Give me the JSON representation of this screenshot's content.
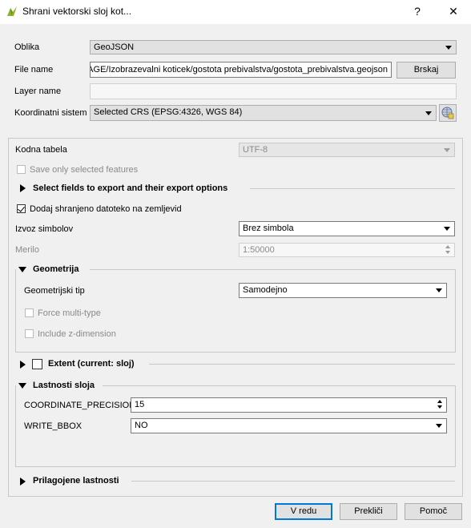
{
  "window": {
    "title": "Shrani vektorski sloj kot...",
    "help_label": "?",
    "close_label": "✕"
  },
  "form": {
    "format_label": "Oblika",
    "format_value": "GeoJSON",
    "filename_label": "File name",
    "filename_value": "AGE/Izobrazevalni koticek/gostota prebivalstva/gostota_prebivalstva.geojson",
    "browse_label": "Brskaj",
    "layername_label": "Layer name",
    "layername_value": "",
    "crs_label": "Koordinatni sistem",
    "crs_value": "Selected CRS (EPSG:4326, WGS 84)"
  },
  "options": {
    "encoding_label": "Kodna tabela",
    "encoding_value": "UTF-8",
    "save_selected_label": "Save only selected features",
    "select_fields_label": "Select fields to export and their export options",
    "add_to_map_label": "Dodaj shranjeno datoteko na zemljevid",
    "add_to_map_checked": true,
    "symbology_label": "Izvoz simbolov",
    "symbology_value": "Brez simbola",
    "scale_label": "Merilo",
    "scale_value": "1:50000"
  },
  "geometry": {
    "group_label": "Geometrija",
    "type_label": "Geometrijski tip",
    "type_value": "Samodejno",
    "force_multi_label": "Force multi-type",
    "include_z_label": "Include z-dimension"
  },
  "extent": {
    "group_label": "Extent (current: sloj)"
  },
  "layer_options": {
    "group_label": "Lastnosti sloja",
    "rows": [
      {
        "key": "COORDINATE_PRECISION",
        "value": "15"
      },
      {
        "key": "WRITE_BBOX",
        "value": "NO"
      }
    ]
  },
  "custom_options": {
    "group_label": "Prilagojene lastnosti"
  },
  "buttons": {
    "ok": "V redu",
    "cancel": "Prekliči",
    "help": "Pomoč"
  }
}
